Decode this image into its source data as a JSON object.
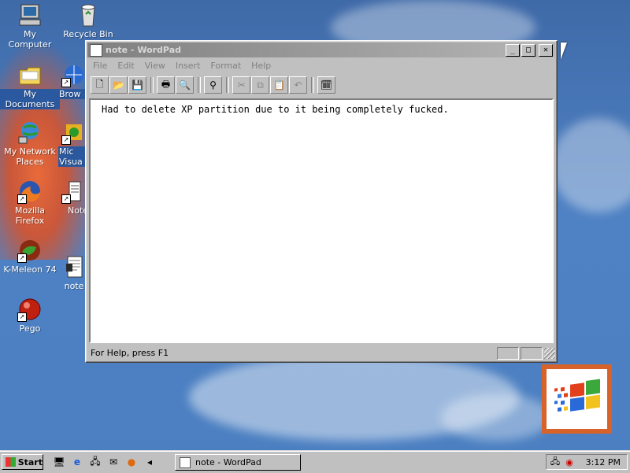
{
  "desktop": {
    "icons": [
      {
        "label": "My Computer",
        "icon": "computer-icon"
      },
      {
        "label": "Recycle Bin",
        "icon": "recycle-bin-icon"
      },
      {
        "label": "My Documents",
        "icon": "folder-icon"
      },
      {
        "label": "Brow",
        "icon": "browser-icon"
      },
      {
        "label": "My Network Places",
        "line1": "My Network",
        "line2": "Places",
        "icon": "network-icon"
      },
      {
        "label": "Mic Visua",
        "line1": "Mic",
        "line2": "Visua",
        "icon": "visual-icon"
      },
      {
        "label": "Mozilla Firefox",
        "icon": "firefox-icon"
      },
      {
        "label": "Note",
        "icon": "notepad-icon"
      },
      {
        "label": "K-Meleon 74",
        "icon": "kmeleon-icon"
      },
      {
        "label": "note",
        "icon": "wordpad-doc-icon"
      },
      {
        "label": "Pego",
        "icon": "pego-icon"
      }
    ]
  },
  "window": {
    "title": "note - WordPad",
    "controls": {
      "minimize": "_",
      "maximize": "□",
      "close": "✕"
    },
    "menu": [
      "File",
      "Edit",
      "View",
      "Insert",
      "Format",
      "Help"
    ],
    "toolbar": [
      "new",
      "open",
      "save",
      "print",
      "print-preview",
      "find",
      "cut",
      "copy",
      "paste",
      "undo",
      "date-time"
    ],
    "document_text": "Had to delete XP partition due to it being completely fucked.",
    "status_text": "For Help, press F1"
  },
  "taskbar": {
    "start_label": "Start",
    "task_label": "note - WordPad",
    "clock": "3:12 PM"
  },
  "colors": {
    "desktop": "#4a7cbf",
    "face": "#c0c0c0",
    "logo_frame": "#d8632a"
  }
}
